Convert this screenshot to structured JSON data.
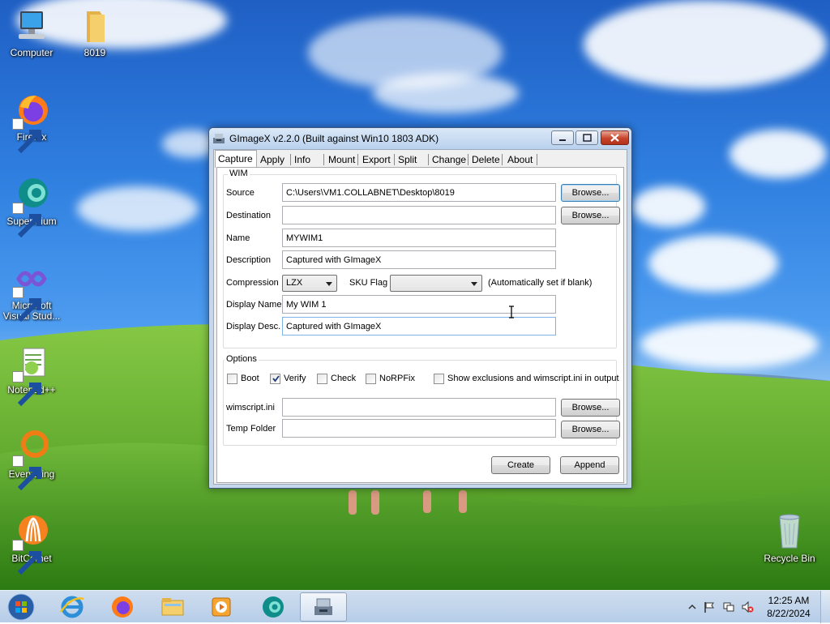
{
  "desktop": {
    "icons": [
      {
        "label": "Computer",
        "icon": "computer-icon"
      },
      {
        "label": "8019",
        "icon": "folder-icon"
      },
      {
        "label": "Firefox",
        "icon": "firefox-icon"
      },
      {
        "label": "Supermium",
        "icon": "supermium-icon"
      },
      {
        "label": "Microsoft Visual Stud...",
        "icon": "visual-studio-icon"
      },
      {
        "label": "Notepad++",
        "icon": "notepadpp-icon"
      },
      {
        "label": "Everything",
        "icon": "everything-icon"
      },
      {
        "label": "BitComet",
        "icon": "bitcomet-icon"
      },
      {
        "label": "Recycle Bin",
        "icon": "recycle-bin-icon"
      }
    ]
  },
  "window": {
    "title": "GImageX v2.2.0 (Built against Win10 1803 ADK)",
    "tabs": [
      "Capture",
      "Apply",
      "Info",
      "Mount",
      "Export",
      "Split",
      "Change",
      "Delete",
      "About"
    ],
    "active_tab": "Capture",
    "wim_group": {
      "title": "WIM",
      "source": {
        "label": "Source",
        "value": "C:\\Users\\VM1.COLLABNET\\Desktop\\8019",
        "browse": "Browse..."
      },
      "destination": {
        "label": "Destination",
        "value": "",
        "browse": "Browse..."
      },
      "name": {
        "label": "Name",
        "value": "MYWIM1"
      },
      "description": {
        "label": "Description",
        "value": "Captured with GImageX"
      },
      "compression": {
        "label": "Compression",
        "value": "LZX"
      },
      "sku_flag": {
        "label": "SKU Flag",
        "value": "",
        "hint": "(Automatically set if blank)"
      },
      "display_name": {
        "label": "Display Name",
        "value": "My WIM 1"
      },
      "display_desc": {
        "label": "Display Desc.",
        "value": "Captured with GImageX"
      }
    },
    "options_group": {
      "title": "Options",
      "checkboxes": [
        {
          "label": "Boot",
          "checked": false
        },
        {
          "label": "Verify",
          "checked": true
        },
        {
          "label": "Check",
          "checked": false
        },
        {
          "label": "NoRPFix",
          "checked": false
        },
        {
          "label": "Show exclusions and wimscript.ini in output",
          "checked": false
        }
      ],
      "wimscript": {
        "label": "wimscript.ini",
        "value": "",
        "browse": "Browse..."
      },
      "temp_folder": {
        "label": "Temp Folder",
        "value": "",
        "browse": "Browse..."
      }
    },
    "buttons": {
      "create": "Create",
      "append": "Append"
    }
  },
  "taskbar": {
    "pinned": [
      "internet-explorer-icon",
      "firefox-icon",
      "file-explorer-icon",
      "media-player-icon",
      "supermium-icon",
      "gimagex-icon"
    ],
    "active": "gimagex-icon",
    "clock": {
      "time": "12:25 AM",
      "date": "8/22/2024"
    }
  },
  "colors": {
    "accent": "#3c7fb1",
    "title_bar": "#c6d7ec",
    "close_button": "#c7432b"
  }
}
